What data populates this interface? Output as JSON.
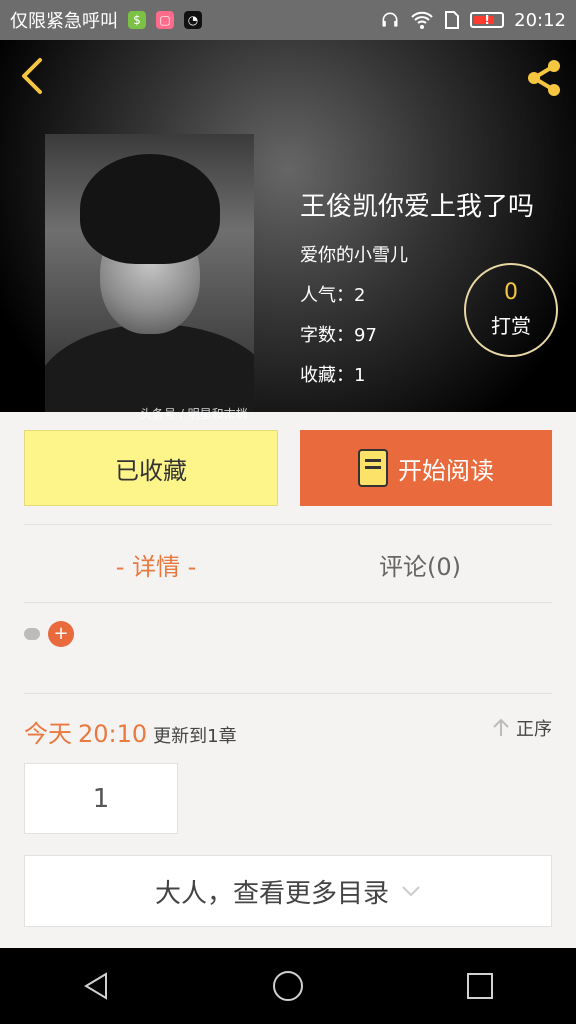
{
  "status_bar": {
    "emergency_text": "仅限紧急呼叫",
    "time": "20:12",
    "battery_warning": "!"
  },
  "book": {
    "title": "王俊凯你爱上我了吗",
    "author": "爱你的小雪儿",
    "popularity": "人气：2",
    "word_count": "字数：97",
    "favorites": "收藏：1",
    "cover_credit": "头条号 / 明星和末梢"
  },
  "tip": {
    "count": "0",
    "label": "打赏"
  },
  "actions": {
    "favorite_label": "已收藏",
    "read_label": "开始阅读"
  },
  "tabs": [
    {
      "label": "- 详情 -"
    },
    {
      "label": "评论(0)"
    }
  ],
  "tags": {
    "add_symbol": "+"
  },
  "update": {
    "day": "今天",
    "time": "20:10",
    "text": "更新到1章",
    "sort_label": "正序"
  },
  "chapters": {
    "first_label": "1"
  },
  "more_button": {
    "label": "大人，查看更多目录"
  },
  "colors": {
    "accent_orange": "#e86a3d",
    "favorite_yellow": "#fdf48a",
    "page_background": "#f4f3f1"
  }
}
